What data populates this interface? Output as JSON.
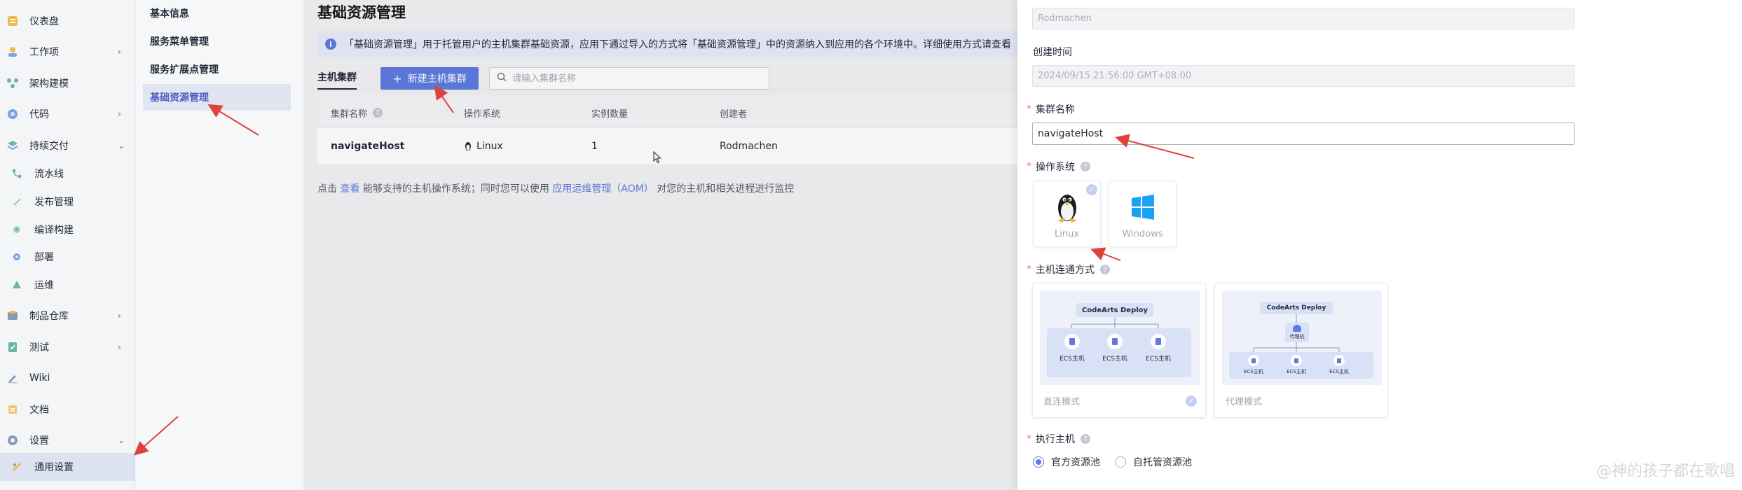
{
  "left_nav": {
    "items": [
      {
        "label": "仪表盘",
        "icon": "dashboard-icon"
      },
      {
        "label": "工作项",
        "icon": "workitem-icon",
        "chevron": "›"
      },
      {
        "label": "架构建模",
        "icon": "architecture-icon"
      },
      {
        "label": "代码",
        "icon": "code-icon",
        "chevron": "›"
      },
      {
        "label": "持续交付",
        "icon": "delivery-icon",
        "chevron": "⌄"
      },
      {
        "label": "流水线",
        "icon": "pipeline-icon"
      },
      {
        "label": "发布管理",
        "icon": "release-icon"
      },
      {
        "label": "编译构建",
        "icon": "build-icon"
      },
      {
        "label": "部署",
        "icon": "deploy-icon"
      },
      {
        "label": "运维",
        "icon": "ops-icon"
      },
      {
        "label": "制品仓库",
        "icon": "artifact-icon",
        "chevron": "›"
      },
      {
        "label": "测试",
        "icon": "test-icon",
        "chevron": "›"
      },
      {
        "label": "Wiki",
        "icon": "wiki-icon"
      },
      {
        "label": "文档",
        "icon": "docs-icon"
      },
      {
        "label": "设置",
        "icon": "settings-icon",
        "chevron": "⌄"
      },
      {
        "label": "通用设置",
        "icon": "general-settings-icon"
      }
    ]
  },
  "sub_nav": {
    "items": [
      {
        "label": "基本信息"
      },
      {
        "label": "服务菜单管理"
      },
      {
        "label": "服务扩展点管理"
      },
      {
        "label": "基础资源管理"
      }
    ]
  },
  "main": {
    "title": "基础资源管理",
    "banner": "「基础资源管理」用于托管用户的主机集群基础资源，应用下通过导入的方式将「基础资源管理」中的资源纳入到应用的各个环境中。详细使用方式请查看",
    "tab": "主机集群",
    "new_button": "新建主机集群",
    "search_placeholder": "请输入集群名称",
    "table": {
      "headers": [
        "集群名称",
        "操作系统",
        "实例数量",
        "创建者"
      ],
      "rows": [
        {
          "name": "navigateHost",
          "os": "Linux",
          "instances": "1",
          "creator": "Rodmachen"
        }
      ]
    },
    "footer": {
      "prefix": "点击",
      "link1": "查看",
      "middle": "能够支持的主机操作系统；同时您可以使用",
      "link2": "应用运维管理（AOM）",
      "suffix": "对您的主机和相关进程进行监控"
    }
  },
  "drawer": {
    "creator_value": "Rodmachen",
    "created_time_label": "创建时间",
    "created_time_value": "2024/09/15 21:56:00 GMT+08:00",
    "cluster_name_label": "集群名称",
    "cluster_name_value": "navigateHost",
    "os_label": "操作系统",
    "os_options": [
      "Linux",
      "Windows"
    ],
    "connect_label": "主机连通方式",
    "connect_options": [
      {
        "name": "直连模式",
        "title": "CodeArts Deploy",
        "hosts": [
          "ECS主机",
          "ECS主机",
          "ECS主机"
        ]
      },
      {
        "name": "代理模式",
        "title": "CodeArts Deploy",
        "proxy": "代理机",
        "hosts": [
          "ECS主机",
          "ECS主机",
          "ECS主机"
        ]
      }
    ],
    "exec_host_label": "执行主机",
    "exec_host_options": [
      "官方资源池",
      "自托管资源池"
    ],
    "watermark": "@神的孩子都在歌唱"
  },
  "colors": {
    "primary": "#5e7ce0",
    "required": "#f66f6a",
    "annotation_arrow": "#e0413e"
  }
}
